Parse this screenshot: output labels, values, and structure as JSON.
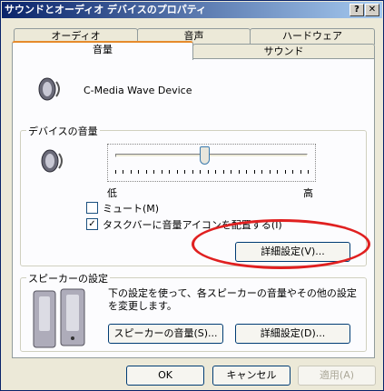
{
  "window": {
    "title": "サウンドとオーディオ デバイスのプロパティ",
    "help_label": "?",
    "close_label": "✕"
  },
  "tabs": {
    "row1": [
      "オーディオ",
      "音声",
      "ハードウェア"
    ],
    "row2": [
      "音量",
      "サウンド"
    ],
    "active": "音量"
  },
  "device": {
    "name": "C-Media Wave Device"
  },
  "device_volume": {
    "group_label": "デバイスの音量",
    "slider_low": "低",
    "slider_high": "高",
    "slider_value": 0.46,
    "mute_label": "ミュート(M)",
    "mute_checked": false,
    "taskbar_label": "タスクバーに音量アイコンを配置する(I)",
    "taskbar_checked": true,
    "check_mark": "✓",
    "advanced_button": "詳細設定(V)..."
  },
  "speakers": {
    "group_label": "スピーカーの設定",
    "description": "下の設定を使って、各スピーカーの音量やその他の設定を変更します。",
    "speaker_volume_button": "スピーカーの音量(S)...",
    "advanced_button": "詳細設定(D)..."
  },
  "footer": {
    "ok": "OK",
    "cancel": "キャンセル",
    "apply": "適用(A)"
  },
  "colors": {
    "annotation": "#e02020",
    "title_gradient_start": "#0a246a"
  }
}
